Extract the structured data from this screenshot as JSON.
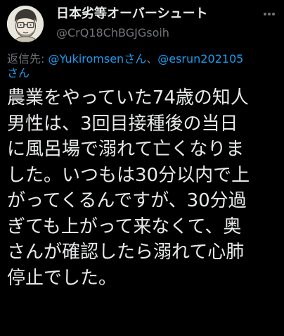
{
  "author": {
    "display_name": "日本劣等オーバーシュート",
    "handle": "@CrQ18ChBGJGsoih"
  },
  "reply": {
    "prefix": "返信先: ",
    "mention_1": "@Yukiromsenさん",
    "separator": "、",
    "mention_2": "@esrun202105",
    "mention_2_suffix": "さん"
  },
  "tweet": {
    "lines": [
      "農業をやっていた74歳の知人",
      "男性は、3回目接種後の当日",
      "に風呂場で溺れて亡くなりま",
      "した。いつもは30分以内で上",
      "がってくるんですが、30分過",
      "ぎても上がって来なくて、奥",
      "さんが確認したら溺れて心肺",
      "停止でした。"
    ]
  },
  "icons": {
    "more": "more-horizontal-icon"
  },
  "colors": {
    "background": "#000000",
    "text": "#e7e9ea",
    "secondary": "#71767b",
    "mention": "#1d9bf0"
  }
}
